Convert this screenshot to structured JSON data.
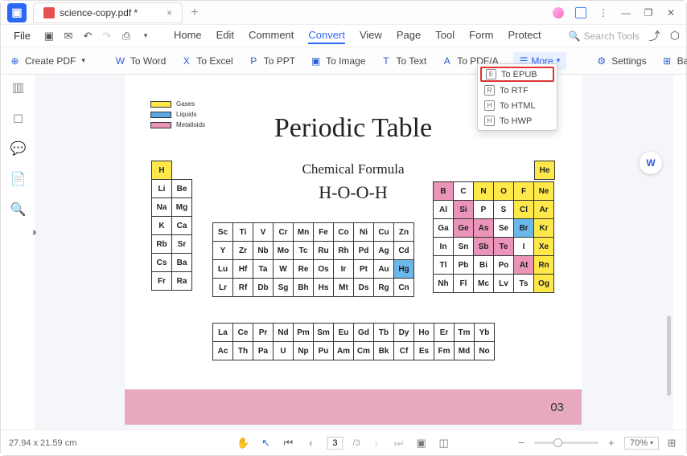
{
  "tab": {
    "title": "science-copy.pdf *"
  },
  "menubar": {
    "file": "File"
  },
  "menu_tabs": [
    "Home",
    "Edit",
    "Comment",
    "Convert",
    "View",
    "Page",
    "Tool",
    "Form",
    "Protect"
  ],
  "menu_active_index": 3,
  "search": {
    "placeholder": "Search Tools"
  },
  "toolbar": {
    "create_pdf": "Create PDF",
    "to_word": "To Word",
    "to_excel": "To Excel",
    "to_ppt": "To PPT",
    "to_image": "To Image",
    "to_text": "To Text",
    "to_pdfa": "To PDF/A",
    "more": "More",
    "settings": "Settings",
    "batch": "Batch Conve"
  },
  "more_menu": {
    "items": [
      {
        "label": "To EPUB",
        "code": "E"
      },
      {
        "label": "To RTF",
        "code": "R"
      },
      {
        "label": "To HTML",
        "code": "H"
      },
      {
        "label": "To HWP",
        "code": "H"
      }
    ],
    "highlighted_index": 0
  },
  "doc": {
    "legend": [
      "Gases",
      "Liquids",
      "Metalloids"
    ],
    "title": "Periodic Table",
    "subtitle": "Chemical Formula",
    "formula": "H-O-O-H",
    "footer_page": "03",
    "grid_left": [
      [
        {
          "s": "H",
          "c": "y"
        }
      ],
      [
        {
          "s": "Li"
        },
        {
          "s": "Be"
        }
      ],
      [
        {
          "s": "Na"
        },
        {
          "s": "Mg"
        }
      ],
      [
        {
          "s": "K"
        },
        {
          "s": "Ca"
        }
      ],
      [
        {
          "s": "Rb"
        },
        {
          "s": "Sr"
        }
      ],
      [
        {
          "s": "Cs"
        },
        {
          "s": "Ba"
        }
      ],
      [
        {
          "s": "Fr"
        },
        {
          "s": "Ra"
        }
      ]
    ],
    "grid_he": [
      [
        {
          "s": "He",
          "c": "y"
        }
      ]
    ],
    "grid_right": [
      [
        {
          "s": "B",
          "c": "p"
        },
        {
          "s": "C"
        },
        {
          "s": "N",
          "c": "y"
        },
        {
          "s": "O",
          "c": "y"
        },
        {
          "s": "F",
          "c": "y"
        },
        {
          "s": "Ne",
          "c": "y"
        }
      ],
      [
        {
          "s": "Al"
        },
        {
          "s": "Si",
          "c": "p"
        },
        {
          "s": "P"
        },
        {
          "s": "S"
        },
        {
          "s": "Cl",
          "c": "y"
        },
        {
          "s": "Ar",
          "c": "y"
        }
      ],
      [
        {
          "s": "Ga"
        },
        {
          "s": "Ge",
          "c": "p"
        },
        {
          "s": "As",
          "c": "p"
        },
        {
          "s": "Se"
        },
        {
          "s": "Br",
          "c": "b"
        },
        {
          "s": "Kr",
          "c": "y"
        }
      ],
      [
        {
          "s": "In"
        },
        {
          "s": "Sn"
        },
        {
          "s": "Sb",
          "c": "p"
        },
        {
          "s": "Te",
          "c": "p"
        },
        {
          "s": "I"
        },
        {
          "s": "Xe",
          "c": "y"
        }
      ],
      [
        {
          "s": "Tl"
        },
        {
          "s": "Pb"
        },
        {
          "s": "Bi"
        },
        {
          "s": "Po"
        },
        {
          "s": "At",
          "c": "p"
        },
        {
          "s": "Rn",
          "c": "y"
        }
      ],
      [
        {
          "s": "Nh"
        },
        {
          "s": "Fl"
        },
        {
          "s": "Mc"
        },
        {
          "s": "Lv"
        },
        {
          "s": "Ts"
        },
        {
          "s": "Og",
          "c": "y"
        }
      ]
    ],
    "grid_mid": [
      [
        {
          "s": "Sc"
        },
        {
          "s": "Ti"
        },
        {
          "s": "V"
        },
        {
          "s": "Cr"
        },
        {
          "s": "Mn"
        },
        {
          "s": "Fe"
        },
        {
          "s": "Co"
        },
        {
          "s": "Ni"
        },
        {
          "s": "Cu"
        },
        {
          "s": "Zn"
        }
      ],
      [
        {
          "s": "Y"
        },
        {
          "s": "Zr"
        },
        {
          "s": "Nb"
        },
        {
          "s": "Mo"
        },
        {
          "s": "Tc"
        },
        {
          "s": "Ru"
        },
        {
          "s": "Rh"
        },
        {
          "s": "Pd"
        },
        {
          "s": "Ag"
        },
        {
          "s": "Cd"
        }
      ],
      [
        {
          "s": "Lu"
        },
        {
          "s": "Hf"
        },
        {
          "s": "Ta"
        },
        {
          "s": "W"
        },
        {
          "s": "Re"
        },
        {
          "s": "Os"
        },
        {
          "s": "Ir"
        },
        {
          "s": "Pt"
        },
        {
          "s": "Au"
        },
        {
          "s": "Hg",
          "c": "b"
        }
      ],
      [
        {
          "s": "Lr"
        },
        {
          "s": "Rf"
        },
        {
          "s": "Db"
        },
        {
          "s": "Sg"
        },
        {
          "s": "Bh"
        },
        {
          "s": "Hs"
        },
        {
          "s": "Mt"
        },
        {
          "s": "Ds"
        },
        {
          "s": "Rg"
        },
        {
          "s": "Cn"
        }
      ]
    ],
    "grid_bottom": [
      [
        {
          "s": "La"
        },
        {
          "s": "Ce"
        },
        {
          "s": "Pr"
        },
        {
          "s": "Nd"
        },
        {
          "s": "Pm"
        },
        {
          "s": "Sm"
        },
        {
          "s": "Eu"
        },
        {
          "s": "Gd"
        },
        {
          "s": "Tb"
        },
        {
          "s": "Dy"
        },
        {
          "s": "Ho"
        },
        {
          "s": "Er"
        },
        {
          "s": "Tm"
        },
        {
          "s": "Yb"
        }
      ],
      [
        {
          "s": "Ac"
        },
        {
          "s": "Th"
        },
        {
          "s": "Pa"
        },
        {
          "s": "U"
        },
        {
          "s": "Np"
        },
        {
          "s": "Pu"
        },
        {
          "s": "Am"
        },
        {
          "s": "Cm"
        },
        {
          "s": "Bk"
        },
        {
          "s": "Cf"
        },
        {
          "s": "Es"
        },
        {
          "s": "Fm"
        },
        {
          "s": "Md"
        },
        {
          "s": "No"
        }
      ]
    ]
  },
  "status": {
    "dims": "27.94 x 21.59 cm",
    "page_current": "3",
    "page_total": "/3",
    "zoom": "70%"
  }
}
